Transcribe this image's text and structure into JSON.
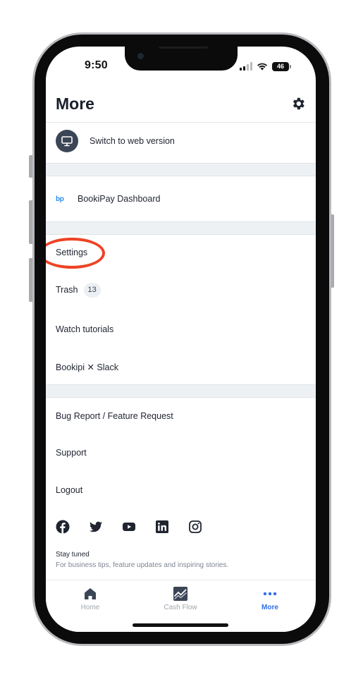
{
  "status_bar": {
    "time": "9:50",
    "battery": "46"
  },
  "header": {
    "title": "More"
  },
  "menu": {
    "web_version": "Switch to web version",
    "bp_logo": "bp",
    "dashboard": "BookiPay Dashboard",
    "settings": "Settings",
    "trash": "Trash",
    "trash_count": "13",
    "tutorials": "Watch tutorials",
    "slack": "Bookipi ✕ Slack",
    "bug_report": "Bug Report / Feature Request",
    "support": "Support",
    "logout": "Logout"
  },
  "social": {
    "icons": [
      "facebook-icon",
      "twitter-icon",
      "youtube-icon",
      "linkedin-icon",
      "instagram-icon"
    ]
  },
  "stay_tuned": {
    "title": "Stay tuned",
    "subtitle": "For business tips, feature updates and inspiring stories."
  },
  "tabs": [
    {
      "label": "Home",
      "icon": "home-icon",
      "active": false
    },
    {
      "label": "Cash Flow",
      "icon": "cash-flow-icon",
      "active": false
    },
    {
      "label": "More",
      "icon": "more-dots-icon",
      "active": true
    }
  ],
  "colors": {
    "accent": "#2f6fe6",
    "highlight_circle": "#ee4325",
    "bp_logo": "#2a8cf0",
    "band": "#eef1f4"
  }
}
